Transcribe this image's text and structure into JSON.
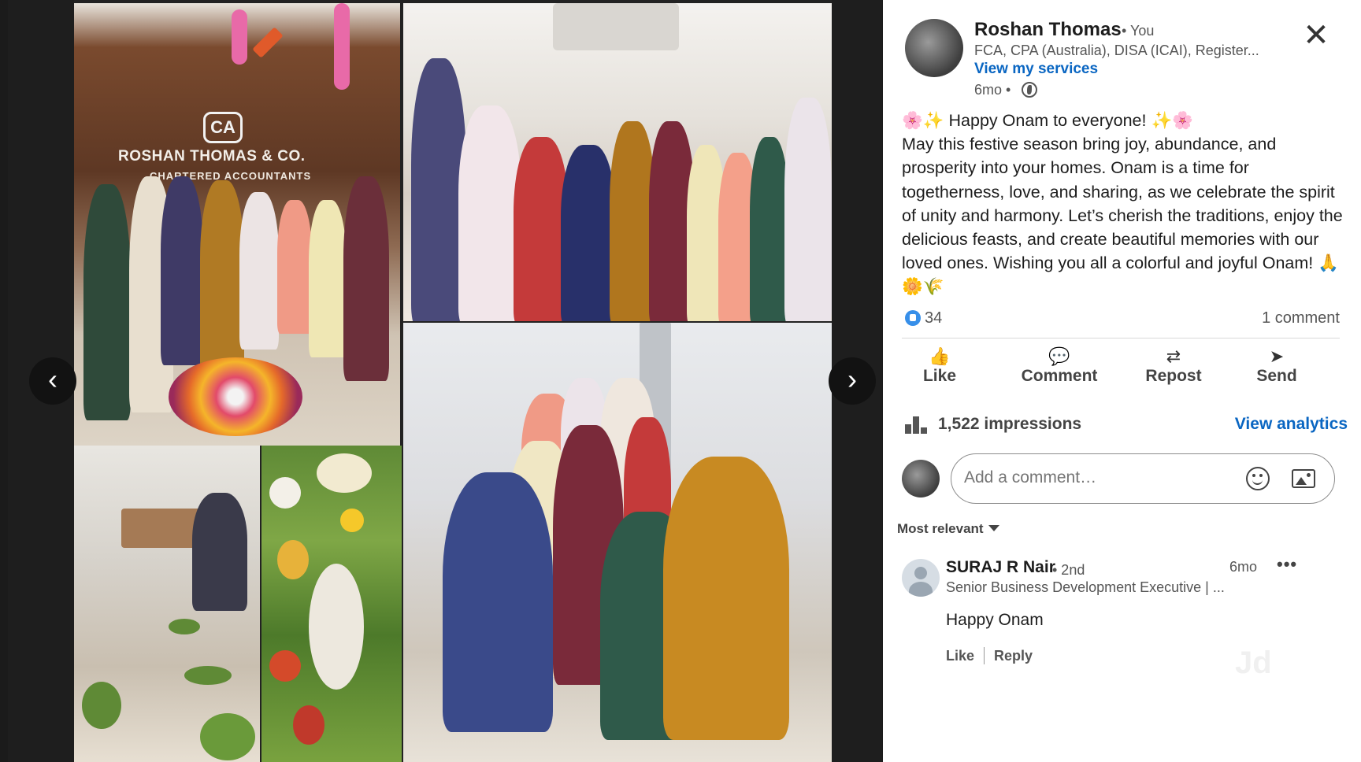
{
  "viewer": {
    "prev_label": "‹",
    "next_label": "›",
    "sign": {
      "logo": "CA",
      "line1": "ROSHAN THOMAS & CO.",
      "line2": "CHARTERED ACCOUNTANTS"
    }
  },
  "post": {
    "author": {
      "name": "Roshan Thomas",
      "you_badge": "• You",
      "headline": "FCA, CPA (Australia), DISA (ICAI), Register...",
      "services_link": "View my services",
      "time": "6mo •"
    },
    "close_label": "✕",
    "body_lines": [
      "🌸✨ Happy Onam to everyone! ✨🌸",
      "May this festive season bring joy, abundance, and prosperity into your homes. Onam is a time for togetherness, love, and sharing, as we celebrate the spirit of unity and harmony. Let’s cherish the traditions, enjoy the delicious feasts, and create beautiful memories with our loved ones. Wishing you all a colorful and joyful Onam! 🙏🌼🌾"
    ],
    "reaction_count": "34",
    "comment_count": "1 comment",
    "actions": {
      "like": "Like",
      "comment": "Comment",
      "repost": "Repost",
      "send": "Send"
    },
    "impressions": "1,522 impressions",
    "view_analytics": "View analytics"
  },
  "comment_input": {
    "placeholder": "Add a comment…"
  },
  "sort_label": "Most relevant",
  "comments": [
    {
      "name": "SURAJ R Nair",
      "degree": "• 2nd",
      "headline": "Senior Business Development Executive | ...",
      "time": "6mo",
      "more": "•••",
      "text": "Happy Onam",
      "like": "Like",
      "reply": "Reply"
    }
  ],
  "watermark": "Jd"
}
